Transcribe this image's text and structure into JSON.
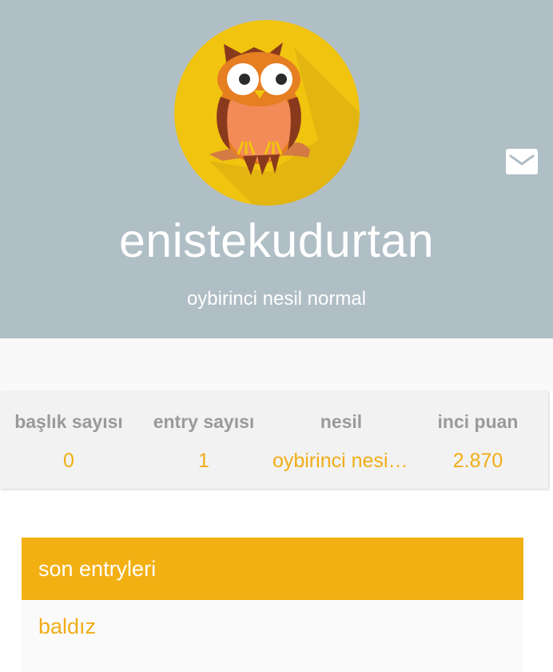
{
  "profile": {
    "username": "enistekudurtan",
    "generation": "oybirinci nesil normal",
    "avatar_icon": "owl-avatar-icon",
    "mail_icon": "mail-icon"
  },
  "stats": [
    {
      "label": "başlık sayısı",
      "value": "0"
    },
    {
      "label": "entry sayısı",
      "value": "1"
    },
    {
      "label": "nesil",
      "value": "oybirinci nesil normal"
    },
    {
      "label": "inci puan",
      "value": "2.870"
    }
  ],
  "entries": {
    "title": "son entryleri",
    "items": [
      "baldız"
    ]
  },
  "colors": {
    "header_bg": "#b0bec5",
    "accent": "#f2b013",
    "stat_value": "#f0ad18",
    "stat_label": "#9a9a9a",
    "avatar_bg": "#f1c40f"
  }
}
